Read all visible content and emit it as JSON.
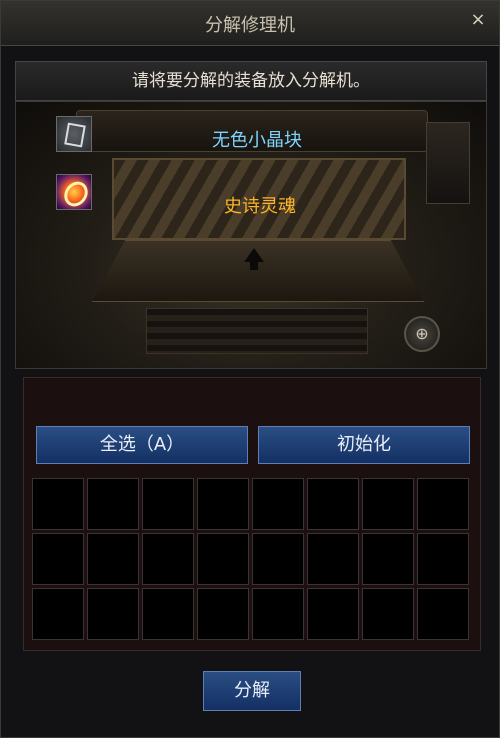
{
  "window": {
    "title": "分解修理机",
    "close_label": "×"
  },
  "instruction": "请将要分解的装备放入分解机。",
  "machine": {
    "items": [
      {
        "name": "无色小晶块",
        "icon": "crystal-cube-icon",
        "color": "#7fd4ff"
      },
      {
        "name": "史诗灵魂",
        "icon": "epic-soul-icon",
        "color": "#ffb428"
      }
    ],
    "knob_glyph": "⊕"
  },
  "buttons": {
    "select_all": "全选（A）",
    "initialize": "初始化",
    "decompose": "分解"
  },
  "slots": {
    "rows": 3,
    "columns": 8
  }
}
